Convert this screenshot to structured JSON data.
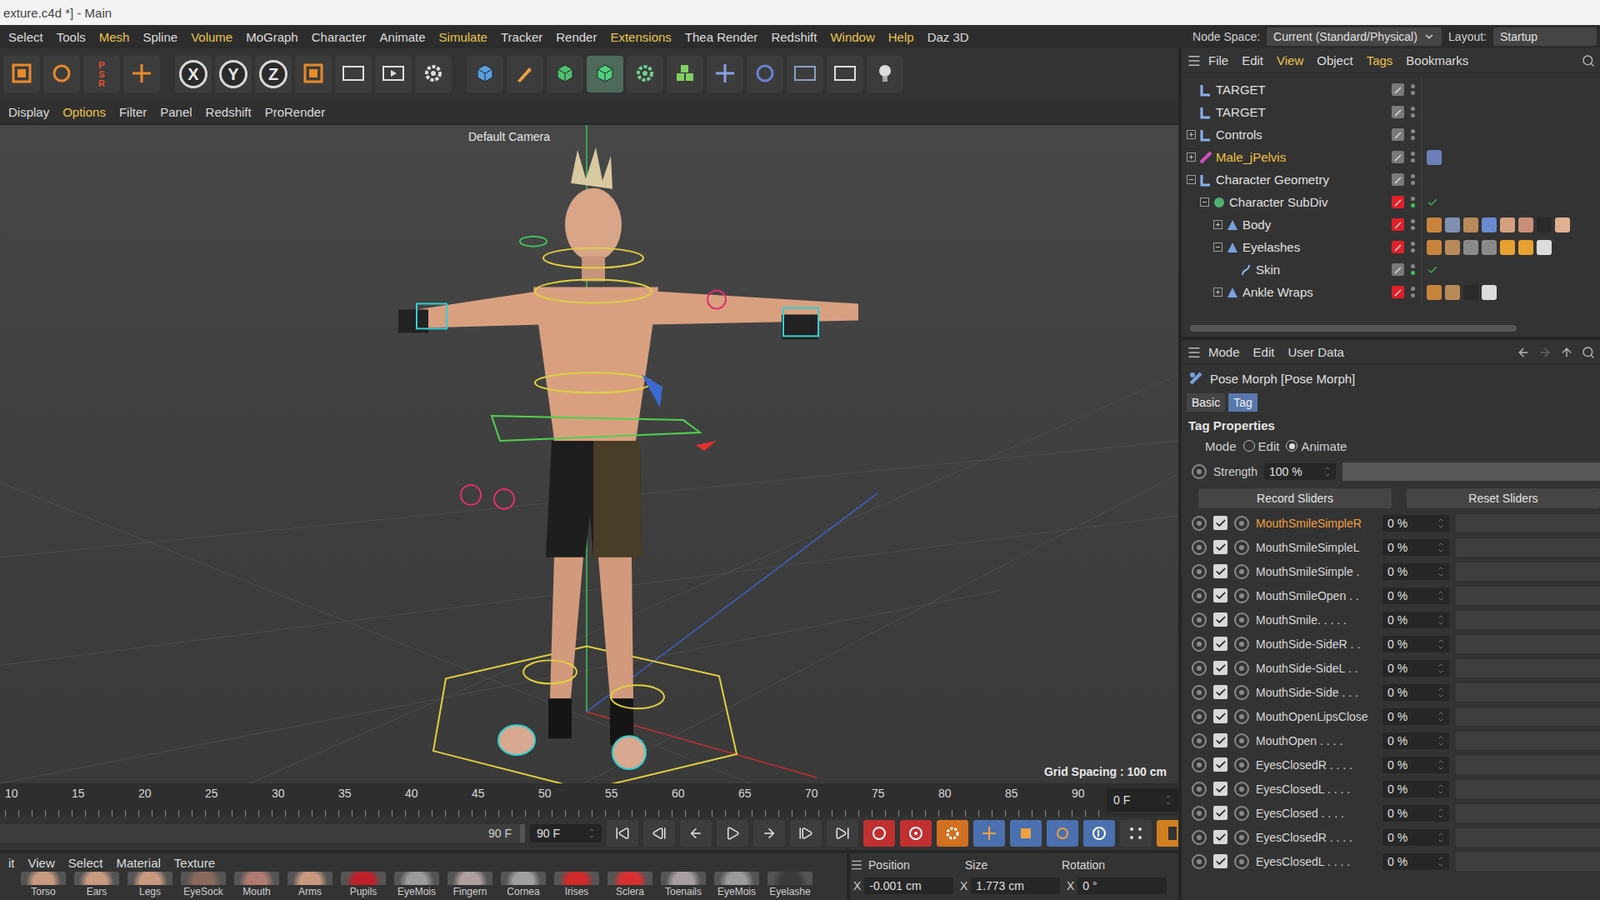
{
  "window": {
    "title": "exture.c4d *] - Main"
  },
  "menu": [
    {
      "label": "Select",
      "highlighted": false
    },
    {
      "label": "Tools",
      "highlighted": false
    },
    {
      "label": "Mesh",
      "highlighted": true
    },
    {
      "label": "Spline",
      "highlighted": false
    },
    {
      "label": "Volume",
      "highlighted": true
    },
    {
      "label": "MoGraph",
      "highlighted": false
    },
    {
      "label": "Character",
      "highlighted": false
    },
    {
      "label": "Animate",
      "highlighted": false
    },
    {
      "label": "Simulate",
      "highlighted": true
    },
    {
      "label": "Tracker",
      "highlighted": false
    },
    {
      "label": "Render",
      "highlighted": false
    },
    {
      "label": "Extensions",
      "highlighted": true
    },
    {
      "label": "Thea Render",
      "highlighted": false
    },
    {
      "label": "Redshift",
      "highlighted": false
    },
    {
      "label": "Window",
      "highlighted": true
    },
    {
      "label": "Help",
      "highlighted": true
    },
    {
      "label": "Daz 3D",
      "highlighted": false
    }
  ],
  "node_space": {
    "label": "Node Space:",
    "value": "Current (Standard/Physical)"
  },
  "layout": {
    "label": "Layout:",
    "value": "Startup"
  },
  "toolbar": {
    "psr_label": "PSR",
    "axis_buttons": [
      {
        "label": "X",
        "on": true
      },
      {
        "label": "Y",
        "on": true
      },
      {
        "label": "Z",
        "on": true
      }
    ]
  },
  "viewport": {
    "menu": [
      {
        "label": "Display",
        "highlighted": false
      },
      {
        "label": "Options",
        "highlighted": true
      },
      {
        "label": "Filter",
        "highlighted": false
      },
      {
        "label": "Panel",
        "highlighted": false
      },
      {
        "label": "Redshift",
        "highlighted": false
      },
      {
        "label": "ProRender",
        "highlighted": false
      }
    ],
    "camera": "Default Camera",
    "grid": "Grid Spacing : 100 cm"
  },
  "objects": {
    "menu": [
      "File",
      "Edit",
      "View",
      "Object",
      "Tags",
      "Bookmarks"
    ],
    "rows": [
      {
        "name": "TARGET",
        "kind": "null",
        "depth": 0,
        "has_children": false,
        "expanded": false,
        "highlighted": false,
        "layer_color": "#7a7a7a",
        "checked": false,
        "tags": []
      },
      {
        "name": "TARGET",
        "kind": "null",
        "depth": 0,
        "has_children": false,
        "expanded": false,
        "highlighted": false,
        "layer_color": "#7a7a7a",
        "checked": false,
        "tags": []
      },
      {
        "name": "Controls",
        "kind": "null",
        "depth": 0,
        "has_children": true,
        "expanded": false,
        "highlighted": false,
        "layer_color": "#7a7a7a",
        "checked": false,
        "tags": []
      },
      {
        "name": "Male_jPelvis",
        "kind": "joint",
        "depth": 0,
        "has_children": true,
        "expanded": false,
        "highlighted": true,
        "layer_color": "#7a7a7a",
        "checked": false,
        "tags": [
          "#6d7fb8"
        ]
      },
      {
        "name": "Character Geometry",
        "kind": "null",
        "depth": 0,
        "has_children": true,
        "expanded": true,
        "highlighted": false,
        "layer_color": "#7a7a7a",
        "checked": false,
        "tags": []
      },
      {
        "name": "Character SubDiv",
        "kind": "subdiv",
        "depth": 1,
        "has_children": true,
        "expanded": true,
        "highlighted": false,
        "layer_color": "#e0202a",
        "checked": true,
        "tags": []
      },
      {
        "name": "Body",
        "kind": "mesh",
        "depth": 2,
        "has_children": true,
        "expanded": false,
        "highlighted": false,
        "layer_color": "#e0202a",
        "checked": false,
        "tags": [
          "#c8843c",
          "#7e8fb0",
          "#b88a5a",
          "#6a8bd0",
          "#d4a080",
          "#c89078",
          "#2a2a2a",
          "#e0b090"
        ]
      },
      {
        "name": "Eyelashes",
        "kind": "mesh",
        "depth": 2,
        "has_children": true,
        "expanded": true,
        "highlighted": false,
        "layer_color": "#e0202a",
        "checked": false,
        "tags": [
          "#c8843c",
          "#b88a5a",
          "#8a8a8a",
          "#8a8a8a",
          "#e8a030",
          "#e8a030",
          "#dddddd"
        ]
      },
      {
        "name": "Skin",
        "kind": "skin",
        "depth": 3,
        "has_children": false,
        "expanded": false,
        "highlighted": false,
        "layer_color": "#7a7a7a",
        "checked": true,
        "tags": []
      },
      {
        "name": "Ankle Wraps",
        "kind": "mesh",
        "depth": 2,
        "has_children": true,
        "expanded": false,
        "highlighted": false,
        "layer_color": "#e0202a",
        "checked": false,
        "tags": [
          "#c8843c",
          "#b88a5a",
          "#2a2a2a",
          "#dddddd"
        ]
      }
    ]
  },
  "attributes": {
    "menu": [
      "Mode",
      "Edit",
      "User Data"
    ],
    "title": "Pose Morph [Pose Morph]",
    "tabs": [
      {
        "label": "Basic",
        "selected": false
      },
      {
        "label": "Tag",
        "selected": true
      }
    ],
    "section": "Tag Properties",
    "mode": {
      "label": "Mode",
      "options": [
        {
          "label": "Edit",
          "selected": false
        },
        {
          "label": "Animate",
          "selected": true
        }
      ]
    },
    "strength": {
      "label": "Strength",
      "value": "100 %",
      "level": 1
    },
    "buttons": [
      "Record Sliders",
      "Reset Sliders"
    ],
    "sliders": [
      {
        "name": "MouthSmileSimpleR",
        "value": "0 %",
        "level": 0,
        "checked": true,
        "selected": true
      },
      {
        "name": "MouthSmileSimpleL",
        "value": "0 %",
        "level": 0,
        "checked": true,
        "selected": false
      },
      {
        "name": "MouthSmileSimple .",
        "value": "0 %",
        "level": 0,
        "checked": true,
        "selected": false
      },
      {
        "name": "MouthSmileOpen . .",
        "value": "0 %",
        "level": 0,
        "checked": true,
        "selected": false
      },
      {
        "name": "MouthSmile. . . . .",
        "value": "0 %",
        "level": 0,
        "checked": true,
        "selected": false
      },
      {
        "name": "MouthSide-SideR . .",
        "value": "0 %",
        "level": 0,
        "checked": true,
        "selected": false
      },
      {
        "name": "MouthSide-SideL . .",
        "value": "0 %",
        "level": 0,
        "checked": true,
        "selected": false
      },
      {
        "name": "MouthSide-Side . . .",
        "value": "0 %",
        "level": 0,
        "checked": true,
        "selected": false
      },
      {
        "name": "MouthOpenLipsClose",
        "value": "0 %",
        "level": 0,
        "checked": true,
        "selected": false
      },
      {
        "name": "MouthOpen . . . .",
        "value": "0 %",
        "level": 0,
        "checked": true,
        "selected": false
      },
      {
        "name": "EyesClosedR . . . .",
        "value": "0 %",
        "level": 0,
        "checked": true,
        "selected": false
      },
      {
        "name": "EyesClosedL . . . .",
        "value": "0 %",
        "level": 0,
        "checked": true,
        "selected": false
      },
      {
        "name": "EyesClosed . . . .",
        "value": "0 %",
        "level": 0,
        "checked": true,
        "selected": false
      },
      {
        "name": "EyesClosedR . . . .",
        "value": "0 %",
        "level": 0,
        "checked": true,
        "selected": false
      },
      {
        "name": "EyesClosedL . . . .",
        "value": "0 %",
        "level": 0,
        "checked": true,
        "selected": false
      }
    ]
  },
  "timeline": {
    "ticks": [
      "10",
      "15",
      "20",
      "25",
      "30",
      "35",
      "40",
      "45",
      "50",
      "55",
      "60",
      "65",
      "70",
      "75",
      "80",
      "85",
      "90"
    ],
    "frame": "0 F"
  },
  "transport": {
    "end_fields": [
      "90 F",
      "90 F"
    ]
  },
  "materials": {
    "menu": [
      "it",
      "View",
      "Select",
      "Material",
      "Texture"
    ],
    "items": [
      {
        "name": "Torso",
        "color": "#c89a80"
      },
      {
        "name": "Ears",
        "color": "#c89a80"
      },
      {
        "name": "Legs",
        "color": "#c89a80"
      },
      {
        "name": "EyeSock",
        "color": "#8a6a5a"
      },
      {
        "name": "Mouth",
        "color": "#b07a70"
      },
      {
        "name": "Arms",
        "color": "#c89a80"
      },
      {
        "name": "Pupils",
        "color": "#c0202a"
      },
      {
        "name": "EyeMois",
        "color": "#9a9a9a"
      },
      {
        "name": "Fingern",
        "color": "#b0a0a0"
      },
      {
        "name": "Cornea",
        "color": "#a0a0a0"
      },
      {
        "name": "Irises",
        "color": "#d02a2a"
      },
      {
        "name": "Sclera",
        "color": "#d83030"
      },
      {
        "name": "Toenails",
        "color": "#a8a0a0"
      },
      {
        "name": "EyeMois",
        "color": "#9a9a9a"
      },
      {
        "name": "Eyelashe",
        "color": "#3a3a3a"
      }
    ]
  },
  "coordinates": {
    "headers": [
      "Position",
      "Size",
      "Rotation"
    ],
    "fields": [
      {
        "axis": "X",
        "value": "-0.001 cm"
      },
      {
        "axis": "X",
        "value": "1.773 cm"
      },
      {
        "axis": "X",
        "value": "0 °"
      }
    ]
  }
}
